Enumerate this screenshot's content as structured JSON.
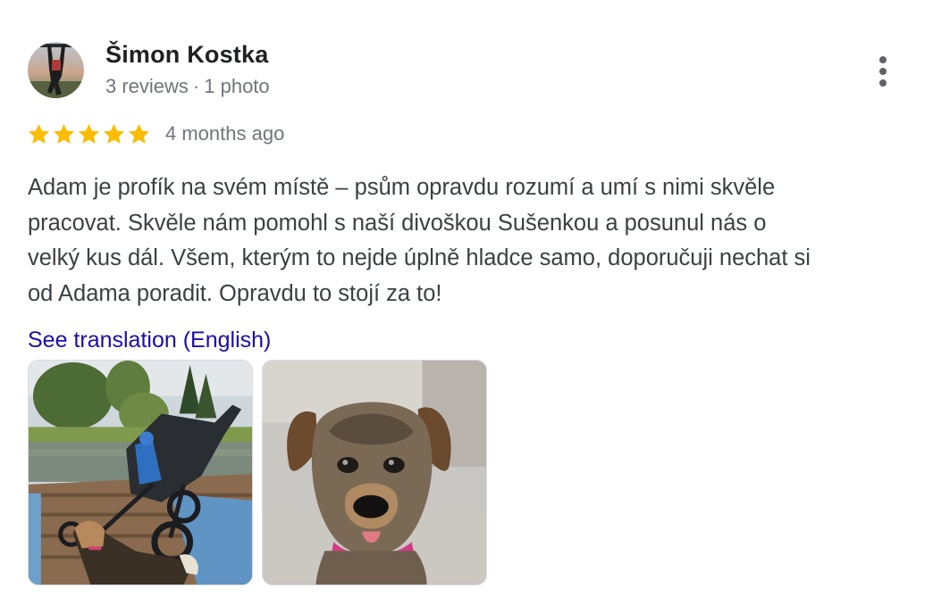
{
  "review": {
    "author_name": "Šimon Kostka",
    "reviews_count": "3 reviews",
    "separator": "·",
    "photos_count": "1 photo",
    "rating": 5,
    "max_rating": 5,
    "time_ago": "4 months ago",
    "text": "Adam je profík na svém místě – psům opravdu rozumí a umí s nimi skvěle\npracovat. Skvěle nám pomohl s naší divoškou Sušenkou a posunul nás o\nvelký kus dál. Všem, kterým to nejde úplně hladce samo, doporučuji nechat si\nod Adama poradit. Opravdu to stojí za to!",
    "translate_link": "See translation (English)",
    "photos": [
      {
        "subject": "lakeside-dock-stroller-dog"
      },
      {
        "subject": "dog-portrait"
      }
    ]
  },
  "colors": {
    "star": "#fbbc04",
    "link": "#1a0dab",
    "secondary_text": "#70757a"
  },
  "icons": {
    "more": "more-vert-icon",
    "star": "star-icon"
  }
}
